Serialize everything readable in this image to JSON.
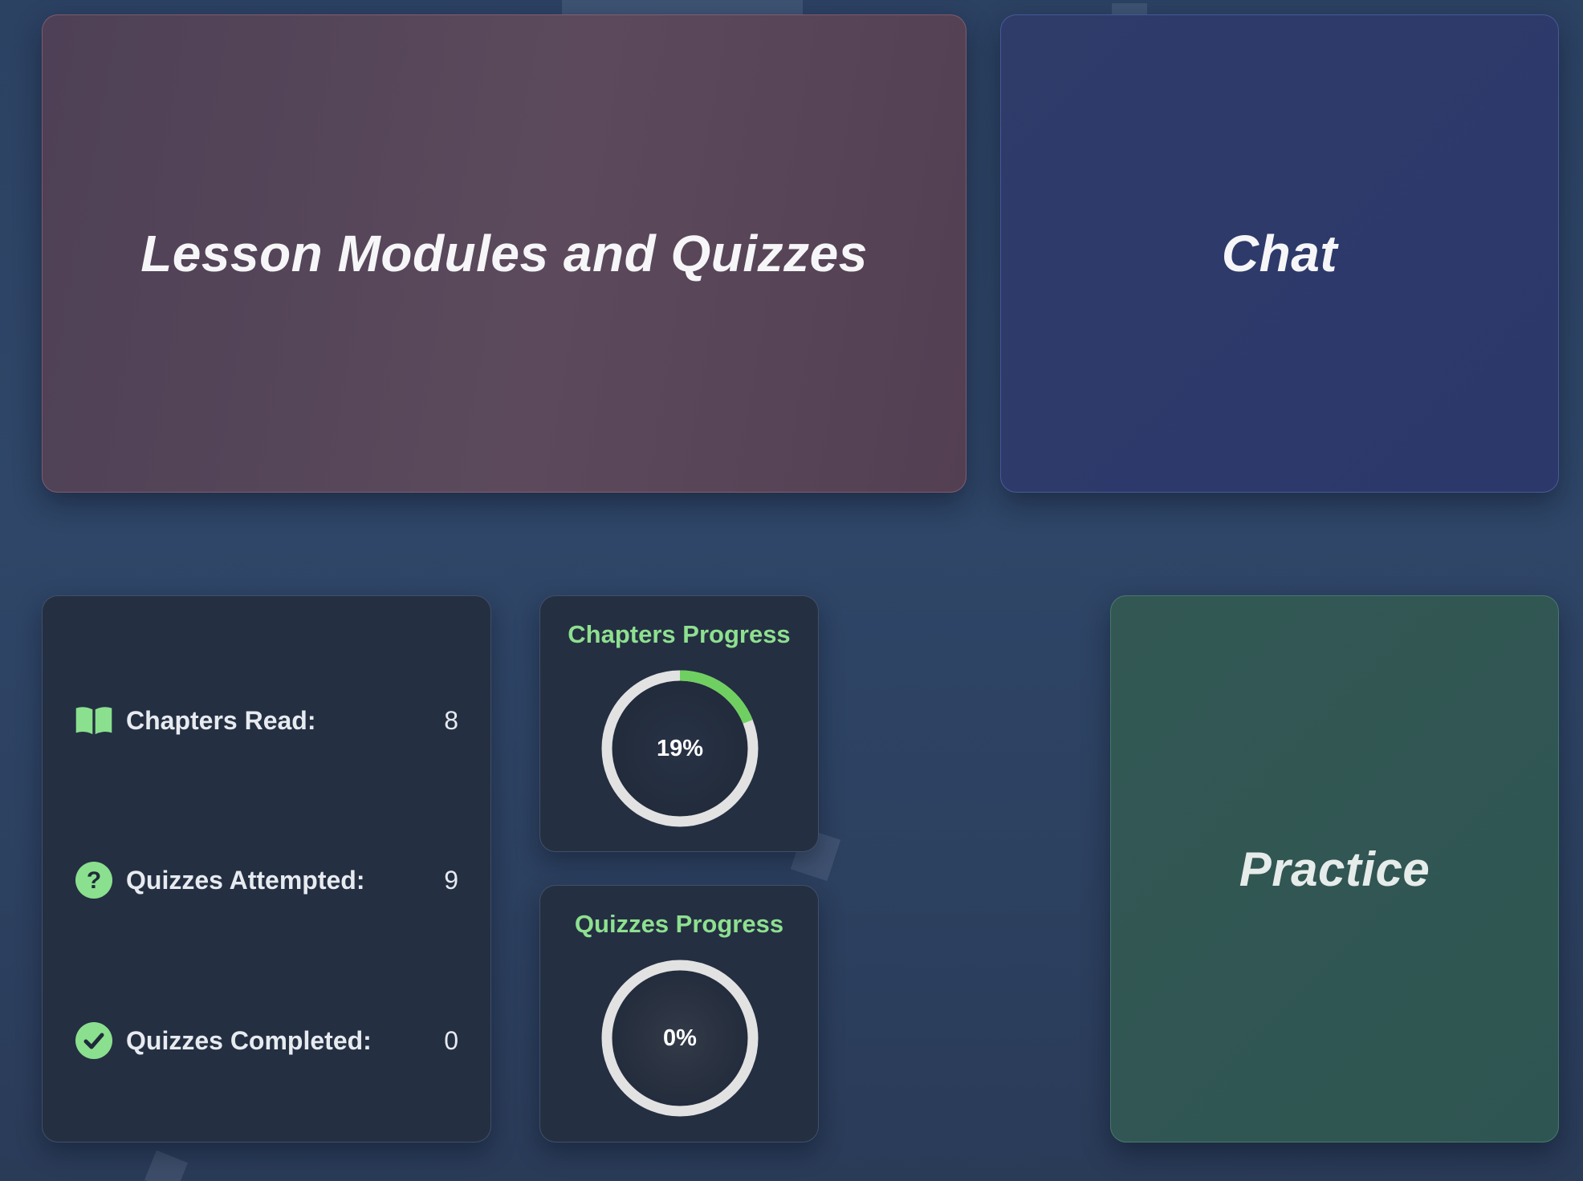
{
  "nav": {
    "lessons_label": "Lesson Modules and Quizzes",
    "chat_label": "Chat",
    "practice_label": "Practice"
  },
  "stats": {
    "chapters_read": {
      "label": "Chapters Read:",
      "value": "8",
      "icon": "book-open-icon"
    },
    "quizzes_attempted": {
      "label": "Quizzes Attempted:",
      "value": "9",
      "icon": "question-circle-icon"
    },
    "quizzes_completed": {
      "label": "Quizzes Completed:",
      "value": "0",
      "icon": "check-circle-icon"
    }
  },
  "progress": {
    "chapters": {
      "title": "Chapters Progress",
      "percent_text": "19%",
      "fraction": 0.19
    },
    "quizzes": {
      "title": "Quizzes Progress",
      "percent_text": "0%",
      "fraction": 0
    }
  },
  "colors": {
    "accent_green": "#8ae08e",
    "ring_fill": "#6fd061",
    "ring_track": "#e2e2e2",
    "lessons_card": "#5a4a5c",
    "chat_card": "#2e3a69",
    "practice_card": "#325754",
    "panel_bg": "#242f42"
  }
}
